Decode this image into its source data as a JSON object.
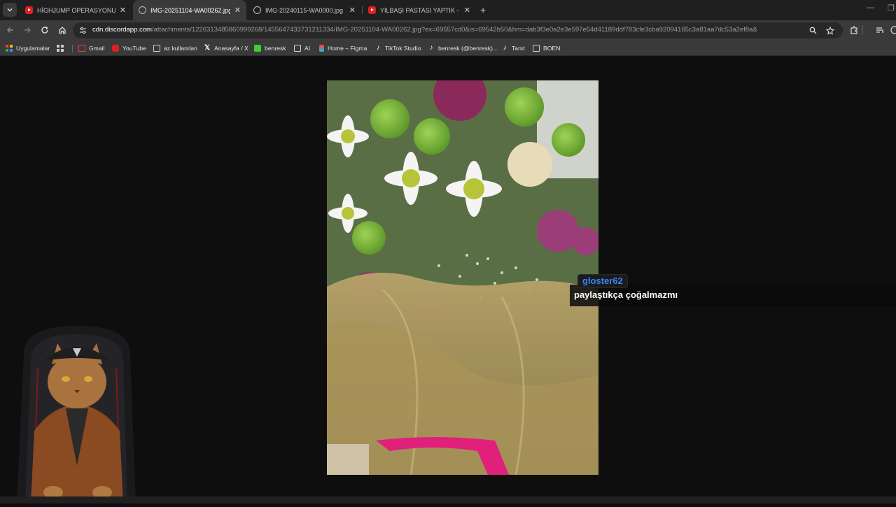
{
  "browser": {
    "tabs": [
      {
        "title": "HİGHJUMP OPERASYONU - An",
        "favicon": "youtube-icon",
        "active": false
      },
      {
        "title": "IMG-20251104-WA00262.jpg (",
        "favicon": "globe-icon",
        "active": true
      },
      {
        "title": "IMG-20240115-WA0000.jpg (1",
        "favicon": "globe-icon",
        "active": false
      },
      {
        "title": "YILBAŞI PASTASI YAPTIK - YouT",
        "favicon": "youtube-icon",
        "active": false
      }
    ],
    "new_tab": "+",
    "url_host": "cdn.discordapp.com",
    "url_path": "/attachments/1226313485860999268/1455647433731211334/IMG-20251104-WA00262.jpg?ex=69557cd0&is=69542b50&hm=dab3f3e0a2e3e597e54d41189ddf783cfe3cba92094165c3a81aa7dc53a2ef8a&",
    "bookmarks": [
      {
        "label": "Uygulamalar",
        "icon": "google-apps-icon"
      },
      {
        "label": "Gmail",
        "icon": "gmail-icon"
      },
      {
        "label": "YouTube",
        "icon": "youtube-icon"
      },
      {
        "label": "az kullanılan",
        "icon": "folder-icon"
      },
      {
        "label": "Anasayfa / X",
        "icon": "x-icon"
      },
      {
        "label": "benresk",
        "icon": "kick-icon"
      },
      {
        "label": "AI",
        "icon": "folder-icon"
      },
      {
        "label": "Home – Figma",
        "icon": "figma-icon"
      },
      {
        "label": "TikTok Studio",
        "icon": "tiktok-icon"
      },
      {
        "label": "benresk (@benresk)...",
        "icon": "tiktok-icon"
      },
      {
        "label": "Tanıt",
        "icon": "tiktok-icon"
      },
      {
        "label": "BOEN",
        "icon": "folder-icon"
      }
    ]
  },
  "chat": {
    "username": "gloster62",
    "username_color": "#3b82f6",
    "message": "paylaştıkça çoğalmazmı"
  },
  "colors": {
    "tabstrip": "#1f1f1f",
    "toolbar": "#3a3a3a",
    "viewer_bg": "#0e0e0e"
  }
}
